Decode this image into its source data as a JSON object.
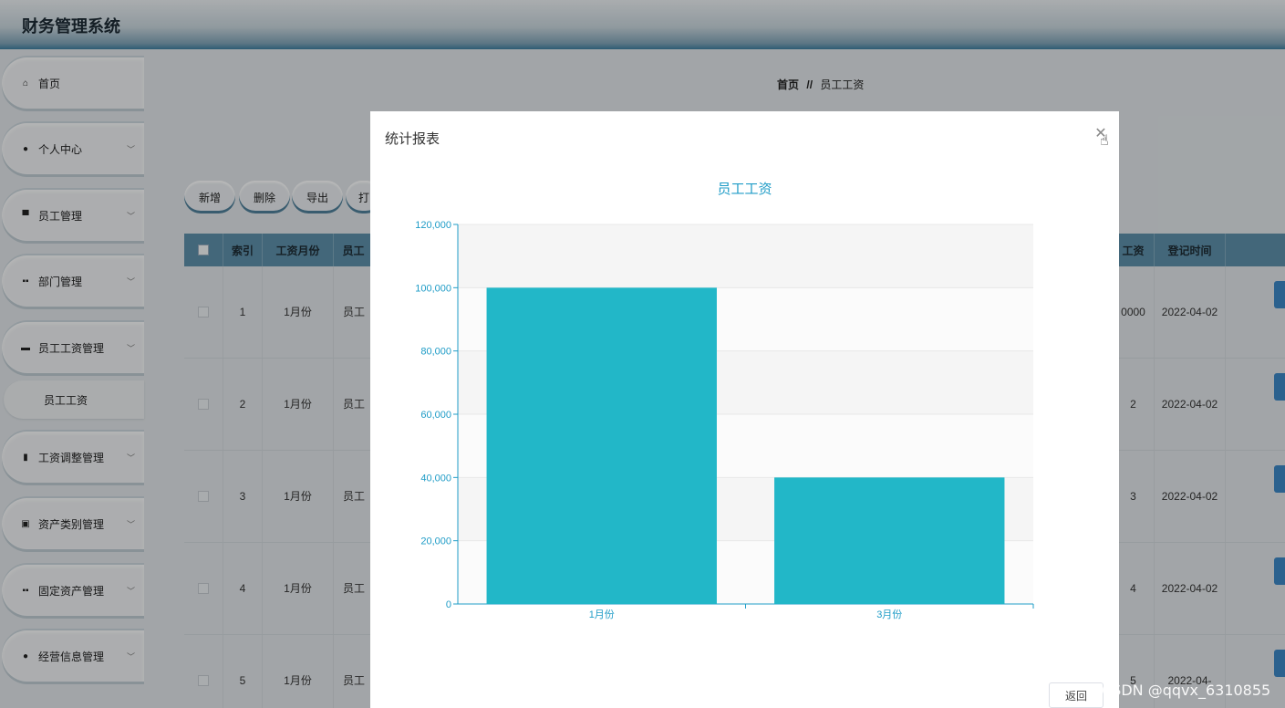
{
  "app": {
    "title": "财务管理系统"
  },
  "sidebar": {
    "items": [
      {
        "label": "首页",
        "icon": "home-icon",
        "has_chevron": false
      },
      {
        "label": "个人中心",
        "icon": "user-icon",
        "has_chevron": true
      },
      {
        "label": "员工管理",
        "icon": "desk-icon",
        "has_chevron": true
      },
      {
        "label": "部门管理",
        "icon": "grid-icon",
        "has_chevron": true
      },
      {
        "label": "员工工资管理",
        "icon": "briefcase-icon",
        "has_chevron": true
      },
      {
        "label": "工资调整管理",
        "icon": "bar-chart-icon",
        "has_chevron": true
      },
      {
        "label": "资产类别管理",
        "icon": "clipboard-icon",
        "has_chevron": true
      },
      {
        "label": "固定资产管理",
        "icon": "grid-icon",
        "has_chevron": true
      },
      {
        "label": "经营信息管理",
        "icon": "lightbulb-icon",
        "has_chevron": true
      }
    ],
    "sub_item": {
      "label": "员工工资"
    }
  },
  "breadcrumb": {
    "home": "首页",
    "separator": "//",
    "current": "员工工资"
  },
  "toolbar": {
    "add": "新增",
    "delete": "删除",
    "export": "导出",
    "print": "打"
  },
  "table": {
    "headers": {
      "index": "索引",
      "month": "工资月份",
      "employee": "员工",
      "salary": "工资",
      "time": "登记时间"
    },
    "rows": [
      {
        "index": "1",
        "month": "1月份",
        "employee": "员工",
        "salary": "0000",
        "time": "2022-04-02"
      },
      {
        "index": "2",
        "month": "1月份",
        "employee": "员工",
        "salary": "2",
        "time": "2022-04-02"
      },
      {
        "index": "3",
        "month": "1月份",
        "employee": "员工",
        "salary": "3",
        "time": "2022-04-02"
      },
      {
        "index": "4",
        "month": "1月份",
        "employee": "员工",
        "salary": "4",
        "time": "2022-04-02"
      },
      {
        "index": "5",
        "month": "1月份",
        "employee": "员工",
        "salary": "5",
        "time": "2022-04-"
      }
    ]
  },
  "modal": {
    "title": "统计报表",
    "close_icon": "close-icon",
    "back_label": "返回"
  },
  "chart_data": {
    "type": "bar",
    "title": "员工工资",
    "categories": [
      "1月份",
      "3月份"
    ],
    "values": [
      100000,
      40000
    ],
    "ylim": [
      0,
      120000
    ],
    "yticks": [
      "0",
      "20,000",
      "40,000",
      "60,000",
      "80,000",
      "100,000",
      "120,000"
    ],
    "xlabel": "",
    "ylabel": "",
    "grid": true,
    "bar_color": "#22b7c8",
    "axis_color": "#1f9cc7"
  },
  "watermark": "CSDN @qqvx_6310855"
}
